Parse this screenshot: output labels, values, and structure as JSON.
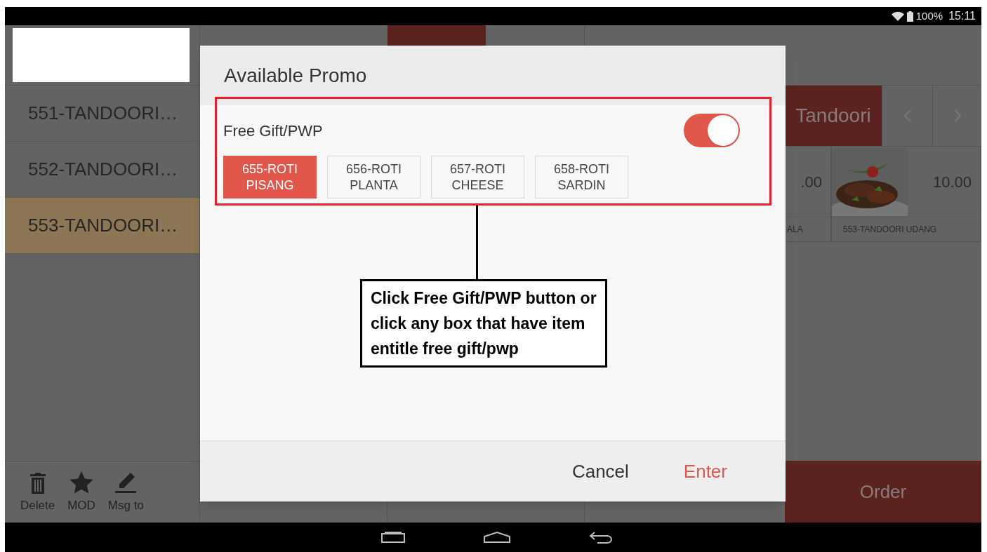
{
  "status_bar": {
    "battery": "100%",
    "time": "15:11"
  },
  "order_items": [
    {
      "name": "551-TANDOORI…",
      "selected": false
    },
    {
      "name": "552-TANDOORI…",
      "selected": false
    },
    {
      "name": "553-TANDOORI…",
      "selected": true
    }
  ],
  "toolbar": [
    {
      "label": "Delete",
      "kind": "delete"
    },
    {
      "label": "MOD",
      "kind": "mod"
    },
    {
      "label": "Msg to",
      "kind": "message"
    }
  ],
  "category_tab": {
    "label": "Tandoori",
    "selected": true
  },
  "menu_items": [
    {
      "price": ".00",
      "name": "ALA",
      "kind": "text"
    },
    {
      "price": "10.00",
      "name": "553-TANDOORI UDANG",
      "kind": "picture"
    }
  ],
  "order_button": "Order",
  "dialog": {
    "title": "Available Promo",
    "promo": {
      "label": "Free Gift/PWP",
      "on": true,
      "items": [
        {
          "label": "655-ROTI PISANG",
          "selected": true
        },
        {
          "label": "656-ROTI PLANTA",
          "selected": false
        },
        {
          "label": "657-ROTI CHEESE",
          "selected": false
        },
        {
          "label": "658-ROTI SARDIN",
          "selected": false
        }
      ]
    },
    "cancel": "Cancel",
    "enter": "Enter"
  },
  "annotation": "Click Free Gift/PWP button or click any box that have item entitle free gift/pwp"
}
